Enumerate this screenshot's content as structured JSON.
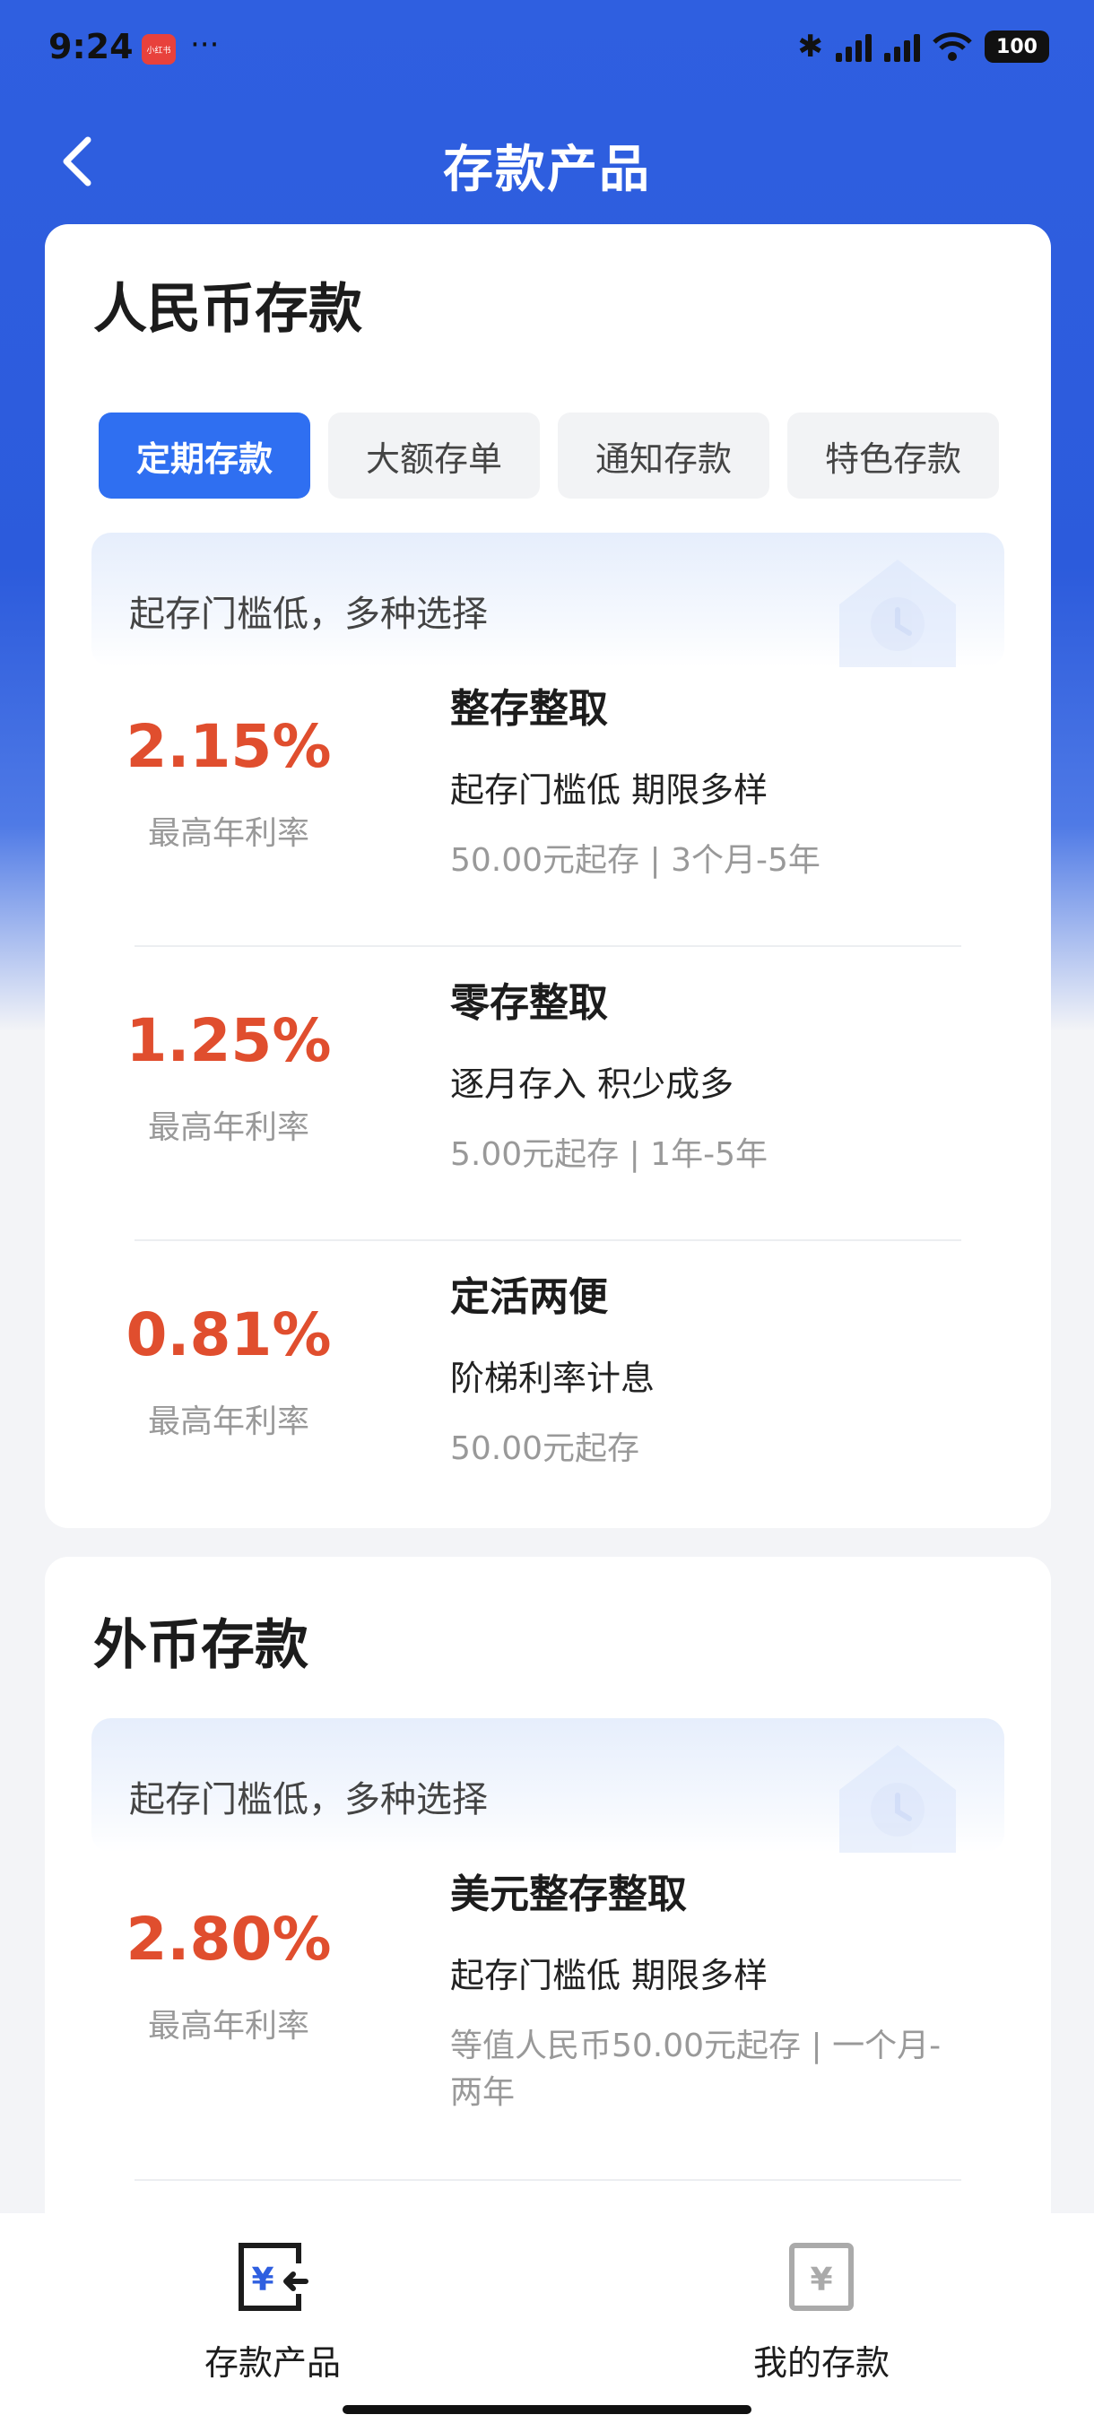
{
  "status_bar": {
    "time": "9:24",
    "app_badge": "小红书",
    "dots": "···",
    "battery": "100"
  },
  "nav": {
    "title": "存款产品"
  },
  "rmb_section": {
    "title": "人民币存款",
    "tabs": [
      {
        "label": "定期存款",
        "active": true
      },
      {
        "label": "大额存单",
        "active": false
      },
      {
        "label": "通知存款",
        "active": false
      },
      {
        "label": "特色存款",
        "active": false
      }
    ],
    "banner_text": "起存门槛低，多种选择",
    "products": [
      {
        "rate": "2.15%",
        "rate_label": "最高年利率",
        "name": "整存整取",
        "feature": "起存门槛低  期限多样",
        "meta": "50.00元起存 | 3个月-5年"
      },
      {
        "rate": "1.25%",
        "rate_label": "最高年利率",
        "name": "零存整取",
        "feature": "逐月存入  积少成多",
        "meta": "5.00元起存 | 1年-5年"
      },
      {
        "rate": "0.81%",
        "rate_label": "最高年利率",
        "name": "定活两便",
        "feature": "阶梯利率计息",
        "meta": "50.00元起存"
      }
    ]
  },
  "fx_section": {
    "title": "外币存款",
    "banner_text": "起存门槛低，多种选择",
    "products": [
      {
        "rate": "2.80%",
        "rate_label": "最高年利率",
        "name": "美元整存整取",
        "feature": "起存门槛低  期限多样",
        "meta": "等值人民币50.00元起存 | 一个月-两年"
      }
    ]
  },
  "bottom_nav": [
    {
      "label": "存款产品",
      "icon": "deposit-products-icon",
      "active": true
    },
    {
      "label": "我的存款",
      "icon": "my-deposits-icon",
      "active": false
    }
  ],
  "colors": {
    "primary": "#2f6ff1",
    "rate": "#e04e2e",
    "header": "#2f5fe0"
  }
}
